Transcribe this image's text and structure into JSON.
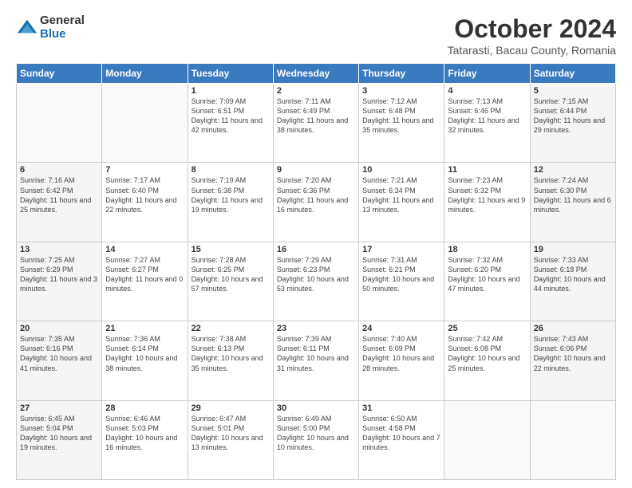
{
  "logo": {
    "general": "General",
    "blue": "Blue"
  },
  "header": {
    "title": "October 2024",
    "location": "Tatarasti, Bacau County, Romania"
  },
  "weekdays": [
    "Sunday",
    "Monday",
    "Tuesday",
    "Wednesday",
    "Thursday",
    "Friday",
    "Saturday"
  ],
  "weeks": [
    [
      {
        "day": "",
        "info": ""
      },
      {
        "day": "",
        "info": ""
      },
      {
        "day": "1",
        "info": "Sunrise: 7:09 AM\nSunset: 6:51 PM\nDaylight: 11 hours and 42 minutes."
      },
      {
        "day": "2",
        "info": "Sunrise: 7:11 AM\nSunset: 6:49 PM\nDaylight: 11 hours and 38 minutes."
      },
      {
        "day": "3",
        "info": "Sunrise: 7:12 AM\nSunset: 6:48 PM\nDaylight: 11 hours and 35 minutes."
      },
      {
        "day": "4",
        "info": "Sunrise: 7:13 AM\nSunset: 6:46 PM\nDaylight: 11 hours and 32 minutes."
      },
      {
        "day": "5",
        "info": "Sunrise: 7:15 AM\nSunset: 6:44 PM\nDaylight: 11 hours and 29 minutes."
      }
    ],
    [
      {
        "day": "6",
        "info": "Sunrise: 7:16 AM\nSunset: 6:42 PM\nDaylight: 11 hours and 25 minutes."
      },
      {
        "day": "7",
        "info": "Sunrise: 7:17 AM\nSunset: 6:40 PM\nDaylight: 11 hours and 22 minutes."
      },
      {
        "day": "8",
        "info": "Sunrise: 7:19 AM\nSunset: 6:38 PM\nDaylight: 11 hours and 19 minutes."
      },
      {
        "day": "9",
        "info": "Sunrise: 7:20 AM\nSunset: 6:36 PM\nDaylight: 11 hours and 16 minutes."
      },
      {
        "day": "10",
        "info": "Sunrise: 7:21 AM\nSunset: 6:34 PM\nDaylight: 11 hours and 13 minutes."
      },
      {
        "day": "11",
        "info": "Sunrise: 7:23 AM\nSunset: 6:32 PM\nDaylight: 11 hours and 9 minutes."
      },
      {
        "day": "12",
        "info": "Sunrise: 7:24 AM\nSunset: 6:30 PM\nDaylight: 11 hours and 6 minutes."
      }
    ],
    [
      {
        "day": "13",
        "info": "Sunrise: 7:25 AM\nSunset: 6:29 PM\nDaylight: 11 hours and 3 minutes."
      },
      {
        "day": "14",
        "info": "Sunrise: 7:27 AM\nSunset: 6:27 PM\nDaylight: 11 hours and 0 minutes."
      },
      {
        "day": "15",
        "info": "Sunrise: 7:28 AM\nSunset: 6:25 PM\nDaylight: 10 hours and 57 minutes."
      },
      {
        "day": "16",
        "info": "Sunrise: 7:29 AM\nSunset: 6:23 PM\nDaylight: 10 hours and 53 minutes."
      },
      {
        "day": "17",
        "info": "Sunrise: 7:31 AM\nSunset: 6:21 PM\nDaylight: 10 hours and 50 minutes."
      },
      {
        "day": "18",
        "info": "Sunrise: 7:32 AM\nSunset: 6:20 PM\nDaylight: 10 hours and 47 minutes."
      },
      {
        "day": "19",
        "info": "Sunrise: 7:33 AM\nSunset: 6:18 PM\nDaylight: 10 hours and 44 minutes."
      }
    ],
    [
      {
        "day": "20",
        "info": "Sunrise: 7:35 AM\nSunset: 6:16 PM\nDaylight: 10 hours and 41 minutes."
      },
      {
        "day": "21",
        "info": "Sunrise: 7:36 AM\nSunset: 6:14 PM\nDaylight: 10 hours and 38 minutes."
      },
      {
        "day": "22",
        "info": "Sunrise: 7:38 AM\nSunset: 6:13 PM\nDaylight: 10 hours and 35 minutes."
      },
      {
        "day": "23",
        "info": "Sunrise: 7:39 AM\nSunset: 6:11 PM\nDaylight: 10 hours and 31 minutes."
      },
      {
        "day": "24",
        "info": "Sunrise: 7:40 AM\nSunset: 6:09 PM\nDaylight: 10 hours and 28 minutes."
      },
      {
        "day": "25",
        "info": "Sunrise: 7:42 AM\nSunset: 6:08 PM\nDaylight: 10 hours and 25 minutes."
      },
      {
        "day": "26",
        "info": "Sunrise: 7:43 AM\nSunset: 6:06 PM\nDaylight: 10 hours and 22 minutes."
      }
    ],
    [
      {
        "day": "27",
        "info": "Sunrise: 6:45 AM\nSunset: 5:04 PM\nDaylight: 10 hours and 19 minutes."
      },
      {
        "day": "28",
        "info": "Sunrise: 6:46 AM\nSunset: 5:03 PM\nDaylight: 10 hours and 16 minutes."
      },
      {
        "day": "29",
        "info": "Sunrise: 6:47 AM\nSunset: 5:01 PM\nDaylight: 10 hours and 13 minutes."
      },
      {
        "day": "30",
        "info": "Sunrise: 6:49 AM\nSunset: 5:00 PM\nDaylight: 10 hours and 10 minutes."
      },
      {
        "day": "31",
        "info": "Sunrise: 6:50 AM\nSunset: 4:58 PM\nDaylight: 10 hours and 7 minutes."
      },
      {
        "day": "",
        "info": ""
      },
      {
        "day": "",
        "info": ""
      }
    ]
  ]
}
